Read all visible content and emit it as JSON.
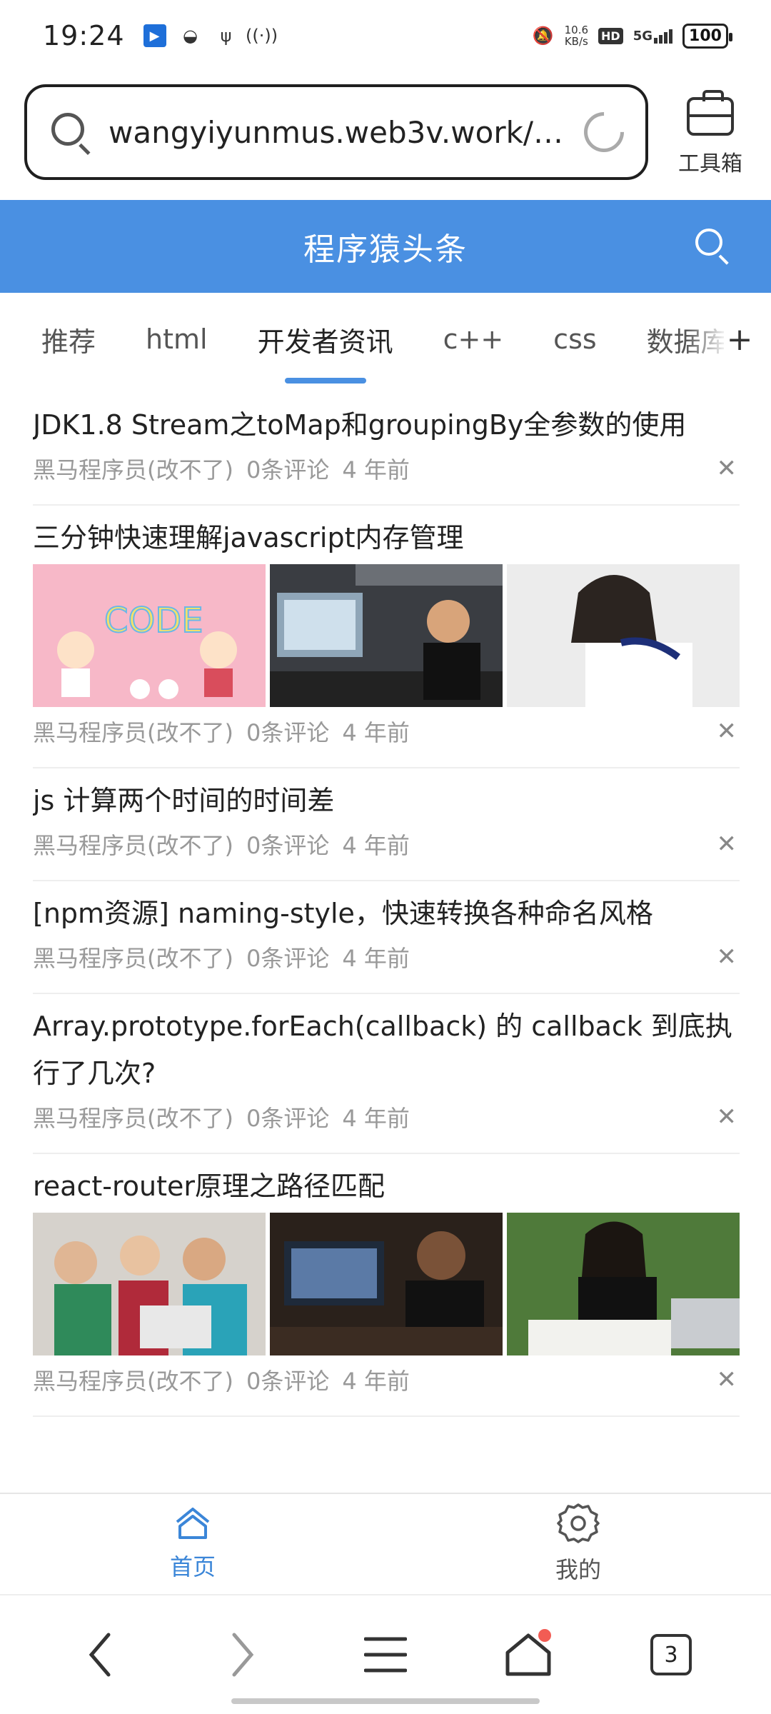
{
  "status_bar": {
    "time": "19:24",
    "speed_value": "10.6",
    "speed_unit": "KB/s",
    "hd": "HD",
    "network": "5G",
    "battery": "100"
  },
  "browser": {
    "url": "wangyiyunmus.web3v.work/…",
    "toolbox_label": "工具箱",
    "tab_count": "3"
  },
  "header": {
    "title": "程序猿头条"
  },
  "tabs": [
    "推荐",
    "html",
    "开发者资讯",
    "c++",
    "css",
    "数据库"
  ],
  "tabs_active_index": 2,
  "articles": [
    {
      "title": "JDK1.8 Stream之toMap和groupingBy全参数的使用",
      "author": "黑马程序员(改不了)",
      "comments": "0条评论",
      "time": "4 年前",
      "images": []
    },
    {
      "title": "三分钟快速理解javascript内存管理",
      "author": "黑马程序员(改不了)",
      "comments": "0条评论",
      "time": "4 年前",
      "images": [
        "cartoon-kids-code",
        "woman-at-computer",
        "girl-sitting"
      ]
    },
    {
      "title": "js 计算两个时间的时间差",
      "author": "黑马程序员(改不了)",
      "comments": "0条评论",
      "time": "4 年前",
      "images": []
    },
    {
      "title": "[npm资源] naming-style，快速转换各种命名风格",
      "author": "黑马程序员(改不了)",
      "comments": "0条评论",
      "time": "4 年前",
      "images": []
    },
    {
      "title": "Array.prototype.forEach(callback) 的 callback 到底执行了几次?",
      "author": "黑马程序员(改不了)",
      "comments": "0条评论",
      "time": "4 年前",
      "images": []
    },
    {
      "title": "react-router原理之路径匹配",
      "author": "黑马程序员(改不了)",
      "comments": "0条评论",
      "time": "4 年前",
      "images": [
        "kids-laptops",
        "woman-coding-dark",
        "student-writing"
      ]
    }
  ],
  "app_nav": {
    "home_label": "首页",
    "mine_label": "我的"
  },
  "colors": {
    "accent": "#4a90e2",
    "nav_active": "#3b86d8",
    "meta_text": "#999999",
    "notification_dot": "#f25c54"
  }
}
